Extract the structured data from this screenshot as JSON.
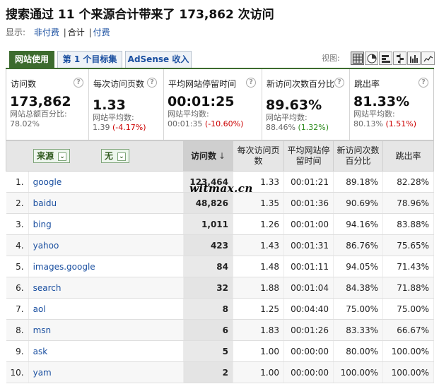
{
  "header": {
    "title": "搜索通过 11 个来源合计带来了 173,862 次访问",
    "display_label": "显示:",
    "filters": [
      "非付费",
      "合计",
      "付费"
    ],
    "active_filter": "合计"
  },
  "tabs": [
    "网站使用",
    "第 1 个目标集",
    "AdSense 收入"
  ],
  "active_tab": "网站使用",
  "view": {
    "label": "视图:",
    "buttons": [
      "table-icon",
      "pie-icon",
      "percent-bar-icon",
      "compare-icon",
      "performance-icon",
      "trend-icon"
    ],
    "active": "table-icon"
  },
  "summary": [
    {
      "label": "访问数",
      "value": "173,862",
      "sub1": "网站总额百分比:",
      "sub2_base": "78.02%",
      "sub2_delta": "",
      "delta_type": ""
    },
    {
      "label": "每次访问页数",
      "value": "1.33",
      "sub1": "网站平均数:",
      "sub2_base": "1.39",
      "sub2_delta": "(-4.17%)",
      "delta_type": "neg"
    },
    {
      "label": "平均网站停留时间",
      "value": "00:01:25",
      "sub1": "网站平均数:",
      "sub2_base": "00:01:35",
      "sub2_delta": "(-10.60%)",
      "delta_type": "neg"
    },
    {
      "label": "新访问次数百分比",
      "value": "89.63%",
      "sub1": "网站平均数:",
      "sub2_base": "88.46%",
      "sub2_delta": "(1.32%)",
      "delta_type": "pos"
    },
    {
      "label": "跳出率",
      "value": "81.33%",
      "sub1": "网站平均数:",
      "sub2_base": "80.13%",
      "sub2_delta": "(1.51%)",
      "delta_type": "neg"
    }
  ],
  "table": {
    "dimension_primary": "来源",
    "dimension_secondary": "无",
    "columns": [
      "访问数",
      "每次访问页数",
      "平均网站停留时间",
      "新访问次数百分比",
      "跳出率"
    ],
    "sort_column": "访问数",
    "sort_indicator": "↓",
    "rows": [
      {
        "idx": "1.",
        "source": "google",
        "visits": "123,464",
        "pages": "1.33",
        "time": "00:01:21",
        "new": "89.18%",
        "bounce": "82.28%"
      },
      {
        "idx": "2.",
        "source": "baidu",
        "visits": "48,826",
        "pages": "1.35",
        "time": "00:01:36",
        "new": "90.69%",
        "bounce": "78.96%"
      },
      {
        "idx": "3.",
        "source": "bing",
        "visits": "1,011",
        "pages": "1.26",
        "time": "00:01:00",
        "new": "94.16%",
        "bounce": "83.88%"
      },
      {
        "idx": "4.",
        "source": "yahoo",
        "visits": "423",
        "pages": "1.43",
        "time": "00:01:31",
        "new": "86.76%",
        "bounce": "75.65%"
      },
      {
        "idx": "5.",
        "source": "images.google",
        "visits": "84",
        "pages": "1.48",
        "time": "00:01:11",
        "new": "94.05%",
        "bounce": "71.43%"
      },
      {
        "idx": "6.",
        "source": "search",
        "visits": "32",
        "pages": "1.88",
        "time": "00:01:04",
        "new": "84.38%",
        "bounce": "71.88%"
      },
      {
        "idx": "7.",
        "source": "aol",
        "visits": "8",
        "pages": "1.25",
        "time": "00:04:40",
        "new": "75.00%",
        "bounce": "75.00%"
      },
      {
        "idx": "8.",
        "source": "msn",
        "visits": "6",
        "pages": "1.83",
        "time": "00:01:26",
        "new": "83.33%",
        "bounce": "66.67%"
      },
      {
        "idx": "9.",
        "source": "ask",
        "visits": "5",
        "pages": "1.00",
        "time": "00:00:00",
        "new": "80.00%",
        "bounce": "100.00%"
      },
      {
        "idx": "10.",
        "source": "yam",
        "visits": "2",
        "pages": "1.00",
        "time": "00:00:00",
        "new": "100.00%",
        "bounce": "100.00%"
      }
    ]
  },
  "watermark": "witmax.cn"
}
